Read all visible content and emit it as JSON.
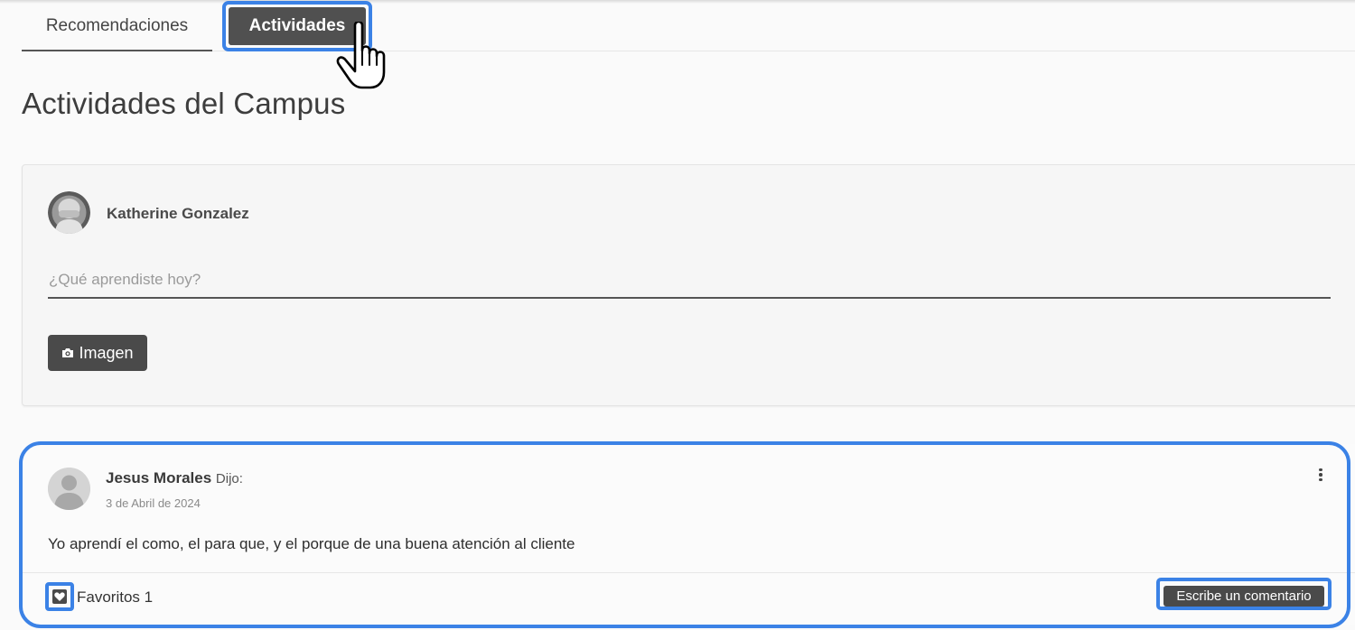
{
  "tabs": [
    {
      "label": "Recomendaciones"
    },
    {
      "label": "Actividades"
    }
  ],
  "page_title": "Actividades del Campus",
  "composer": {
    "user_name": "Katherine Gonzalez",
    "placeholder": "¿Qué aprendiste hoy?",
    "value": "",
    "image_button_label": "Imagen"
  },
  "post": {
    "author": "Jesus Morales",
    "said_label": "Dijo:",
    "date": "3 de Abril de 2024",
    "body": "Yo aprendí el como, el para que, y el porque de una buena atención al cliente",
    "favorites_label": "Favoritos 1",
    "comment_button_label": "Escribe un comentario"
  },
  "colors": {
    "highlight": "#3b82e6",
    "button_dark": "#4a4a4a",
    "active_tab": "#505050"
  },
  "icons": [
    "pointing-hand-cursor-icon",
    "camera-icon",
    "kebab-menu-icon",
    "heart-icon",
    "user-avatar-icon"
  ]
}
